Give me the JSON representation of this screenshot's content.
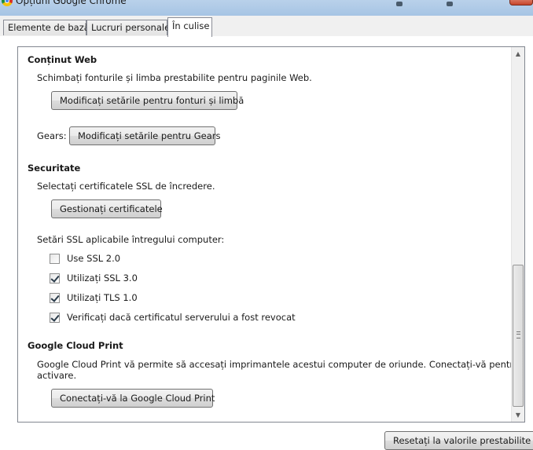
{
  "window": {
    "title": "Opțiuni Google Chrome"
  },
  "tabs": [
    {
      "label": "Elemente de bază"
    },
    {
      "label": "Lucruri personale"
    },
    {
      "label": "În culise"
    }
  ],
  "web_content": {
    "title": "Conținut Web",
    "description": "Schimbați fonturile și limba prestabilite pentru paginile Web.",
    "fonts_button": "Modificați setările pentru fonturi și limbă",
    "gears_label": "Gears:",
    "gears_button": "Modificați setările pentru Gears"
  },
  "security": {
    "title": "Securitate",
    "description": "Selectați certificatele SSL de încredere.",
    "certs_button": "Gestionați certificatele",
    "ssl_heading": "Setări SSL aplicabile întregului computer:",
    "options": [
      {
        "label": "Use SSL 2.0",
        "checked": false
      },
      {
        "label": "Utilizați SSL 3.0",
        "checked": true
      },
      {
        "label": "Utilizați TLS 1.0",
        "checked": true
      },
      {
        "label": "Verificați dacă certificatul serverului a fost revocat",
        "checked": true
      }
    ]
  },
  "cloud_print": {
    "title": "Google Cloud Print",
    "description_line1": "Google Cloud Print vă permite să accesați imprimantele acestui computer de oriunde. Conectați-vă pentru",
    "description_line2": "activare.",
    "connect_button": "Conectați-vă la Google Cloud Print"
  },
  "footer": {
    "reset_button": "Resetați la valorile prestabilite"
  }
}
